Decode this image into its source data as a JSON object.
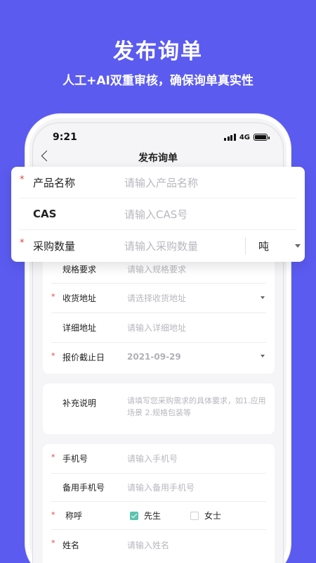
{
  "hero": {
    "title": "发布询单",
    "subtitle": "人工+AI双重审核，确保询单真实性"
  },
  "status_bar": {
    "time": "9:21",
    "network": "4G"
  },
  "navbar": {
    "title": "发布询单"
  },
  "floating_card": {
    "rows": [
      {
        "required": "*",
        "label": "产品名称",
        "placeholder": "请输入产品名称"
      },
      {
        "required": "",
        "label": "CAS",
        "placeholder": "请输入CAS号"
      },
      {
        "required": "*",
        "label": "采购数量",
        "placeholder": "请输入采购数量",
        "unit": "吨"
      }
    ]
  },
  "form_card": {
    "rows": [
      {
        "required": "",
        "label": "规格要求",
        "placeholder": "请输入规格要求"
      },
      {
        "required": "*",
        "label": "收货地址",
        "placeholder": "请选择收货地址"
      },
      {
        "required": "",
        "label": "详细地址",
        "placeholder": "请输入详细地址"
      },
      {
        "required": "*",
        "label": "报价截止日",
        "value": "2021-09-29"
      }
    ]
  },
  "supplement": {
    "label": "补充说明",
    "placeholder": "请填写您采购需求的具体要求，如1.应用场景 2.规格包装等"
  },
  "contact_card": {
    "mobile": {
      "required": "*",
      "label": "手机号",
      "placeholder": "请输入手机号"
    },
    "backup": {
      "required": "",
      "label": "备用手机号",
      "placeholder": "请输入备用手机号"
    },
    "title": {
      "required": "*",
      "label": "称呼",
      "option_a": "先生",
      "option_b": "女士",
      "selected": "先生"
    },
    "name": {
      "required": "*",
      "label": "姓名",
      "placeholder": "请输入姓名"
    }
  },
  "colors": {
    "background": "#5b5bf0",
    "required": "#e0443f",
    "check": "#5cc3b0"
  }
}
